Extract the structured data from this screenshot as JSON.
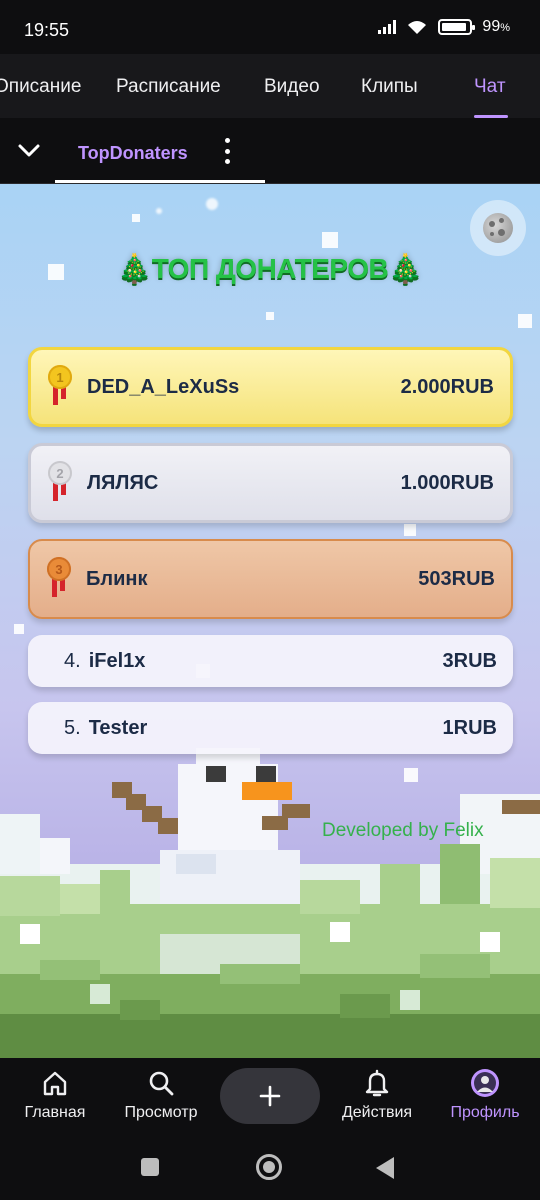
{
  "status_bar": {
    "time": "19:55",
    "battery": "99",
    "battery_unit": "%"
  },
  "channel_tabs": [
    {
      "label": "Описание"
    },
    {
      "label": "Расписание"
    },
    {
      "label": "Видео"
    },
    {
      "label": "Клипы"
    },
    {
      "label": "Чат",
      "active": true
    }
  ],
  "extension_bar": {
    "tab_label": "TopDonaters"
  },
  "panel": {
    "title": "🎄ТОП ДОНАТЕРОВ🎄",
    "donors": [
      {
        "rank": "1",
        "name": "DED_A_LeXuSs",
        "amount": "2.000RUB",
        "tier": "gold"
      },
      {
        "rank": "2",
        "name": "ЛЯЛЯС",
        "amount": "1.000RUB",
        "tier": "silver"
      },
      {
        "rank": "3",
        "name": "Блинк",
        "amount": "503RUB",
        "tier": "bronze"
      },
      {
        "rank": "4.",
        "name": "iFel1x",
        "amount": "3RUB"
      },
      {
        "rank": "5.",
        "name": "Tester",
        "amount": "1RUB"
      }
    ],
    "credit": "Developed by Felix"
  },
  "bottom_nav": [
    {
      "label": "Главная",
      "icon": "home-icon"
    },
    {
      "label": "Просмотр",
      "icon": "search-icon"
    },
    {
      "label": "",
      "icon": "plus-icon"
    },
    {
      "label": "Действия",
      "icon": "bell-icon"
    },
    {
      "label": "Профиль",
      "icon": "avatar-icon",
      "active": true
    }
  ],
  "colors": {
    "accent": "#bf94ff",
    "title_green": "#25c247",
    "background": "#0e0e10"
  }
}
